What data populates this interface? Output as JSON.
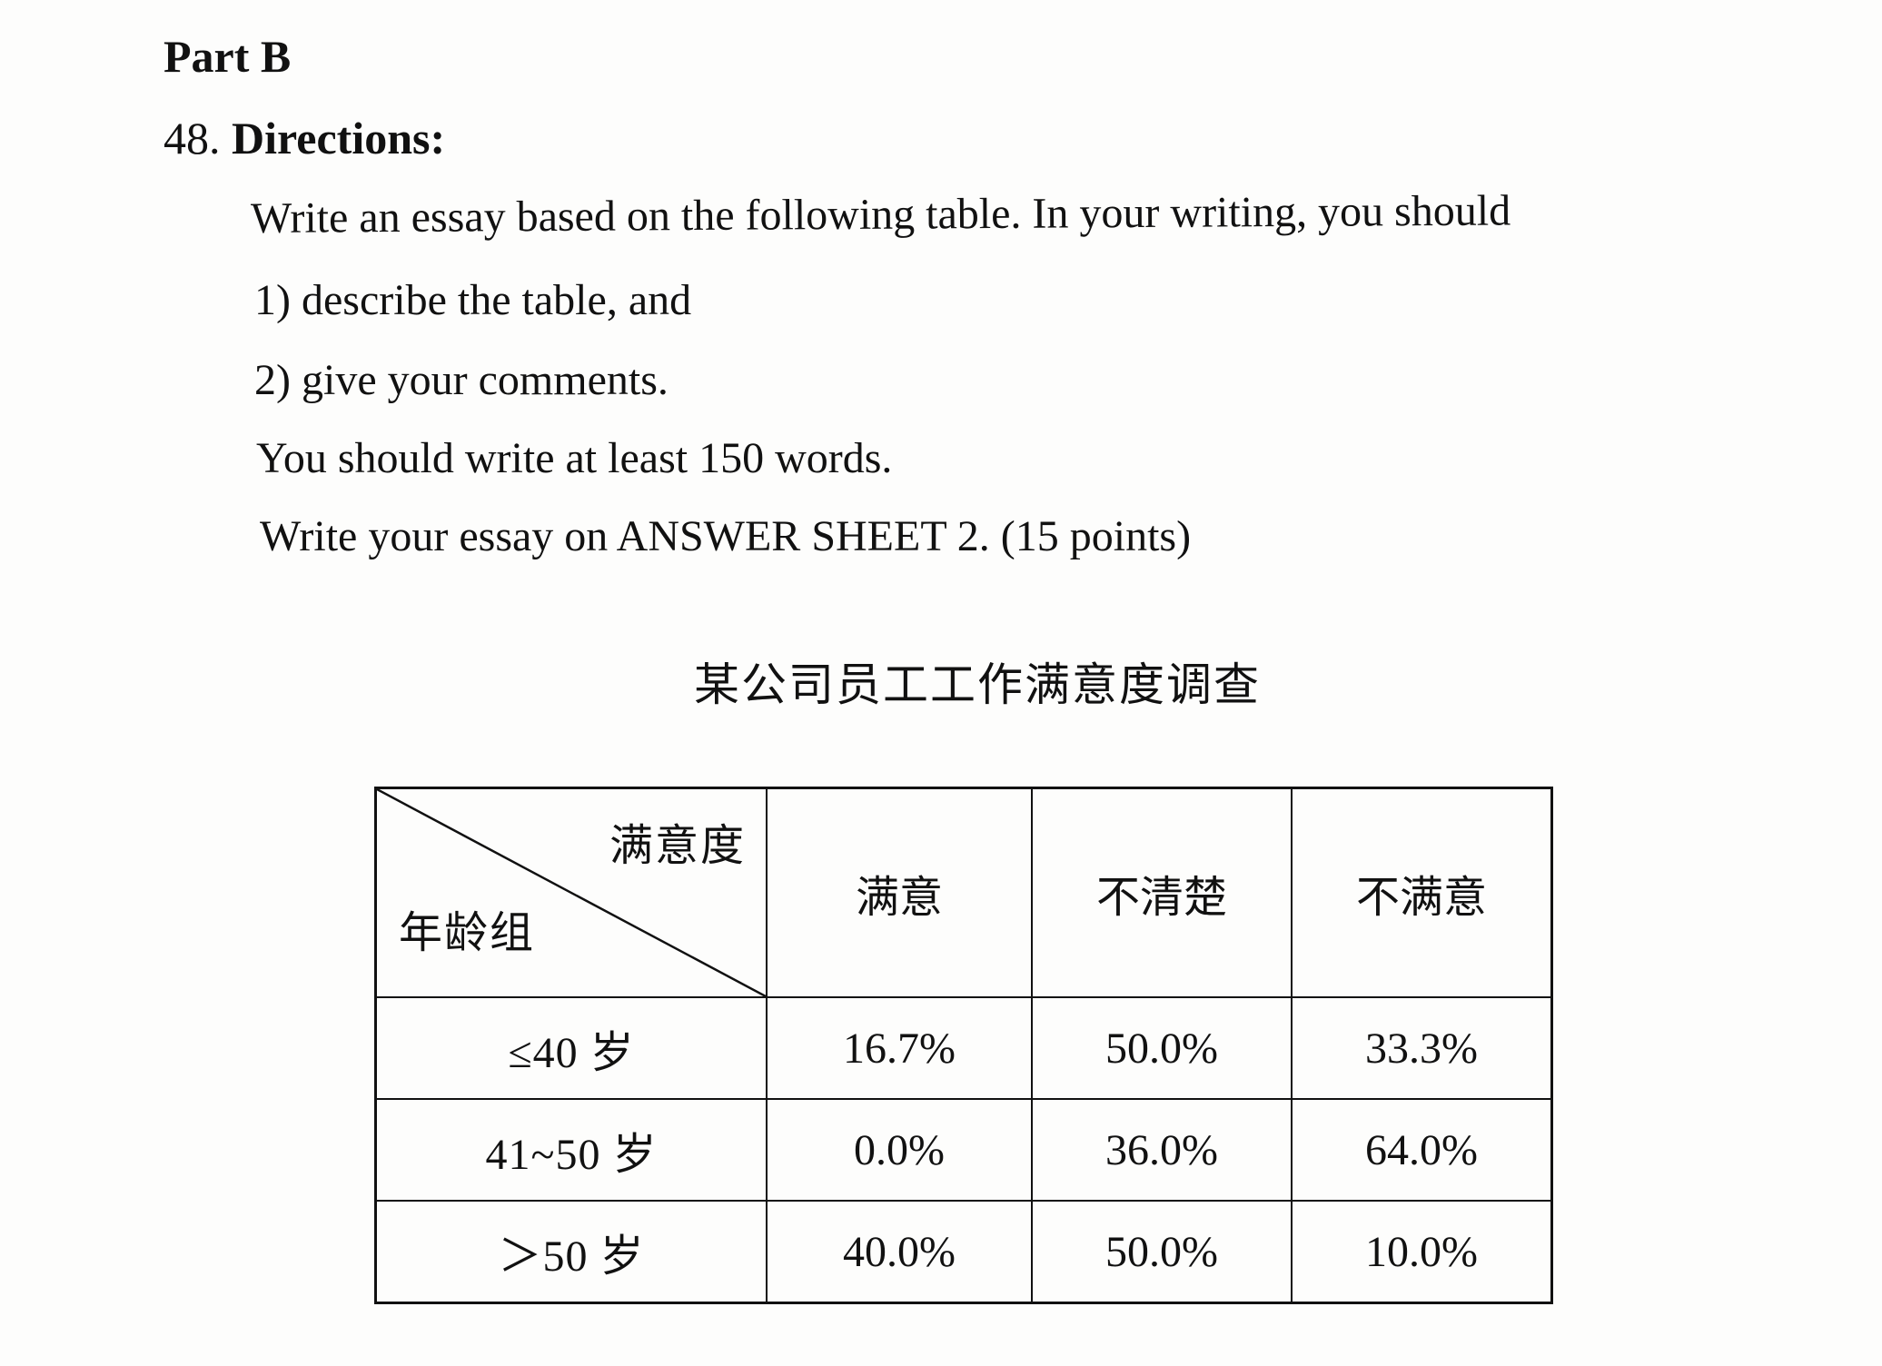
{
  "part": "Part B",
  "question": {
    "number": "48.",
    "heading": "Directions:",
    "lines": [
      "Write an essay based on the following table. In your writing, you should",
      "1) describe the table, and",
      "2) give your comments.",
      "You should write at least 150 words.",
      "Write your essay on ANSWER SHEET 2. (15 points)"
    ]
  },
  "table": {
    "title": "某公司员工工作满意度调查",
    "corner_top": "满意度",
    "corner_bottom": "年龄组",
    "columns": [
      "满意",
      "不清楚",
      "不满意"
    ],
    "rows": [
      {
        "label": "≤40 岁",
        "values": [
          "16.7%",
          "50.0%",
          "33.3%"
        ]
      },
      {
        "label": "41~50 岁",
        "values": [
          "0.0%",
          "36.0%",
          "64.0%"
        ]
      },
      {
        "label": "＞50 岁",
        "values": [
          "40.0%",
          "50.0%",
          "10.0%"
        ]
      }
    ]
  }
}
